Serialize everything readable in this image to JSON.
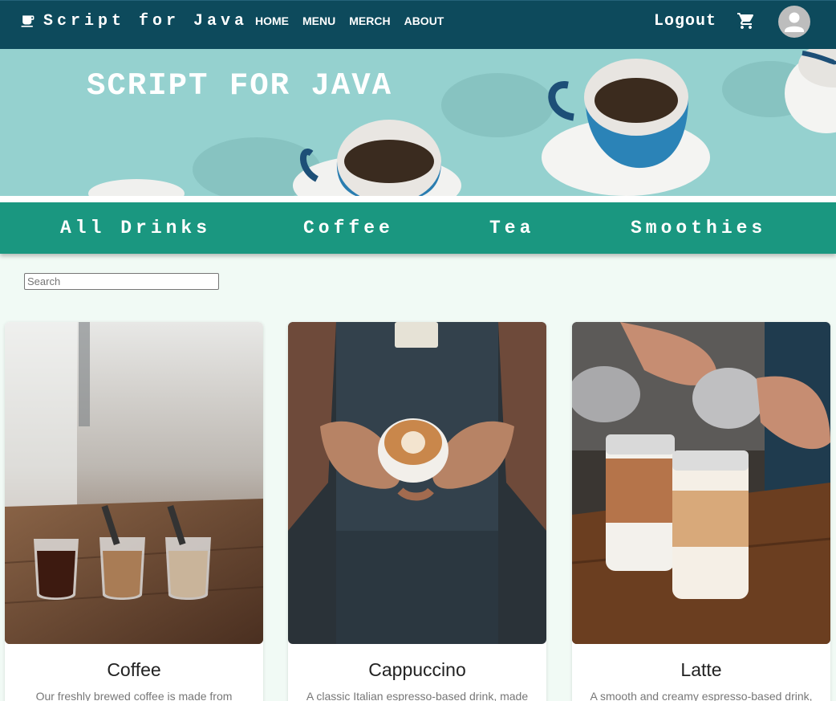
{
  "header": {
    "brand": "Script for Java",
    "nav": [
      "HOME",
      "MENU",
      "MERCH",
      "ABOUT"
    ],
    "logout_label": "Logout"
  },
  "hero": {
    "title": "SCRIPT FOR JAVA"
  },
  "categories": [
    "All Drinks",
    "Coffee",
    "Tea",
    "Smoothies"
  ],
  "search": {
    "placeholder": "Search",
    "value": ""
  },
  "products": [
    {
      "name": "Coffee",
      "description": "Our freshly brewed coffee is made from"
    },
    {
      "name": "Cappuccino",
      "description": "A classic Italian espresso-based drink, made"
    },
    {
      "name": "Latte",
      "description": "A smooth and creamy espresso-based drink,"
    }
  ],
  "colors": {
    "nav_bg": "#0d4a5c",
    "category_bg": "#1a9780",
    "hero_bg": "#95d1cf",
    "page_bg": "#f1faf5"
  },
  "icons": [
    "coffee-cup-icon",
    "cart-icon",
    "user-icon"
  ]
}
